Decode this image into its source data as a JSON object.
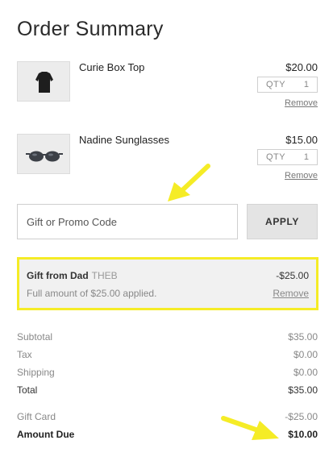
{
  "page": {
    "title": "Order Summary"
  },
  "items": [
    {
      "name": "Curie Box Top",
      "price": "$20.00",
      "qty_label": "QTY",
      "qty": "1",
      "remove": "Remove",
      "image": "black-top-thumbnail"
    },
    {
      "name": "Nadine Sunglasses",
      "price": "$15.00",
      "qty_label": "QTY",
      "qty": "1",
      "remove": "Remove",
      "image": "sunglasses-thumbnail"
    }
  ],
  "promo": {
    "placeholder": "Gift or Promo Code",
    "apply_label": "APPLY"
  },
  "gift": {
    "name": "Gift from Dad",
    "code": "THEB",
    "amount": "-$25.00",
    "note": "Full amount of $25.00 applied.",
    "remove": "Remove",
    "highlight_color": "#f5ec26"
  },
  "totals": {
    "subtotal_label": "Subtotal",
    "subtotal": "$35.00",
    "tax_label": "Tax",
    "tax": "$0.00",
    "shipping_label": "Shipping",
    "shipping": "$0.00",
    "total_label": "Total",
    "total": "$35.00",
    "giftcard_label": "Gift Card",
    "giftcard": "-$25.00",
    "due_label": "Amount Due",
    "due": "$10.00"
  },
  "annotations": {
    "arrow_color": "#f5ec26",
    "icons": [
      "arrow-annotation-icon",
      "arrow-annotation-icon"
    ]
  }
}
